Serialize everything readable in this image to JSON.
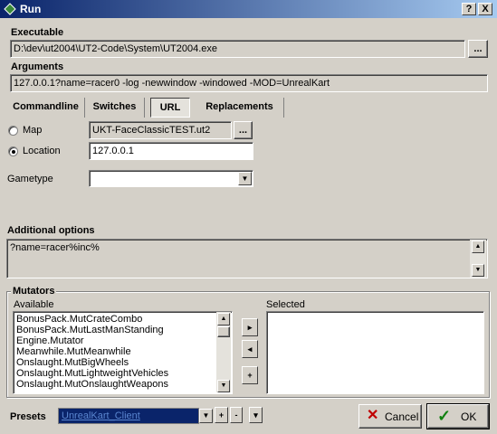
{
  "window": {
    "title": "Run",
    "help_label": "?",
    "close_label": "X"
  },
  "executable": {
    "label": "Executable",
    "value": "D:\\dev\\ut2004\\UT2-Code\\System\\UT2004.exe",
    "browse_label": "..."
  },
  "arguments": {
    "label": "Arguments",
    "value": "127.0.0.1?name=racer0 -log -newwindow -windowed -MOD=UnrealKart"
  },
  "tabs": [
    {
      "label": "Commandline"
    },
    {
      "label": "Switches"
    },
    {
      "label": "URL",
      "active": true
    },
    {
      "label": "Replacements"
    }
  ],
  "url": {
    "map_label": "Map",
    "map_value": "UKT-FaceClassicTEST.ut2",
    "map_browse": "...",
    "location_label": "Location",
    "location_value": "127.0.0.1",
    "selected_radio": "location",
    "gametype_label": "Gametype",
    "gametype_value": ""
  },
  "additional_options": {
    "label": "Additional options",
    "value": "?name=racer%inc%"
  },
  "mutators": {
    "label": "Mutators",
    "available_label": "Available",
    "selected_label": "Selected",
    "available": [
      "BonusPack.MutCrateCombo",
      "BonusPack.MutLastManStanding",
      "Engine.Mutator",
      "Meanwhile.MutMeanwhile",
      "Onslaught.MutBigWheels",
      "Onslaught.MutLightweightVehicles",
      "Onslaught.MutOnslaughtWeapons"
    ],
    "selected": [],
    "move_right": "▸",
    "move_left": "◂",
    "add": "+"
  },
  "presets": {
    "label": "Presets",
    "value": "UnrealKart_Client",
    "add_label": "+",
    "remove_label": "-",
    "more_label": "▾"
  },
  "buttons": {
    "cancel_label": "Cancel",
    "ok_label": "OK"
  },
  "colors": {
    "titlebar_start": "#0a246a",
    "titlebar_end": "#a6caf0",
    "face": "#d4d0c8",
    "selection": "#0a246a"
  }
}
